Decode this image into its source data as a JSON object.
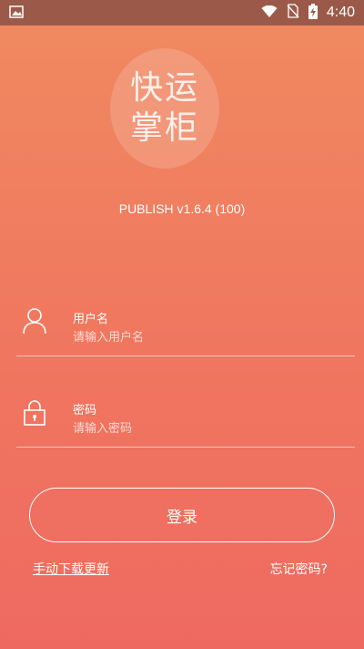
{
  "status_bar": {
    "time": "4:40",
    "icons": [
      "image-icon",
      "wifi-icon",
      "no-sim-icon",
      "battery-charging-icon"
    ]
  },
  "logo": {
    "line1": "快运",
    "line2": "掌柜"
  },
  "version": "PUBLISH v1.6.4 (100)",
  "form": {
    "username": {
      "label": "用户名",
      "placeholder": "请输入用户名",
      "value": ""
    },
    "password": {
      "label": "密码",
      "placeholder": "请输入密码",
      "value": ""
    }
  },
  "login_button": "登录",
  "manual_update": "手动下载更新",
  "forgot_password": "忘记密码?"
}
